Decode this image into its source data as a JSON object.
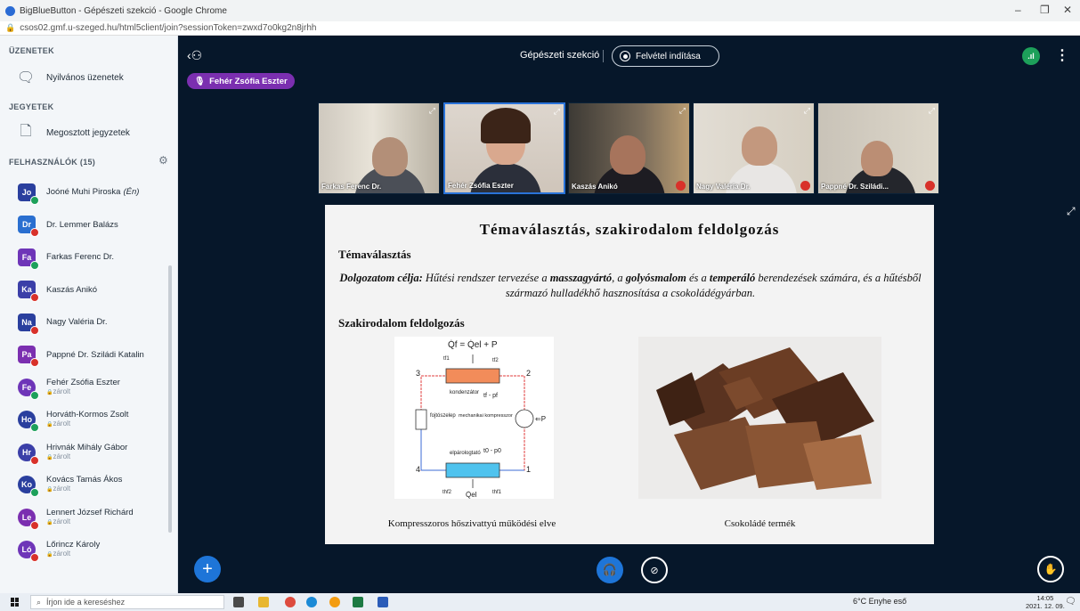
{
  "browser": {
    "title": "BigBlueButton - Gépészeti szekció - Google Chrome",
    "url": "csos02.gmf.u-szeged.hu/html5client/join?sessionToken=zwxd7o0kg2n8jrhh"
  },
  "sidebar": {
    "messages_title": "ÜZENETEK",
    "public_chat": "Nyilvános üzenetek",
    "notes_title": "JEGYETEK",
    "shared_notes": "Megosztott jegyzetek",
    "users_title": "FELHASZNÁLÓK (15)",
    "users": [
      {
        "initials": "Jo",
        "name": "Joóné Muhi Piroska",
        "self": "(Én)",
        "sub": "",
        "color": "#2a3f9e",
        "badge": "#1da05a"
      },
      {
        "initials": "Dr",
        "name": "Dr. Lemmer Balázs",
        "self": "",
        "sub": "",
        "color": "#2a6fd0",
        "badge": "#d8312a"
      },
      {
        "initials": "Fa",
        "name": "Farkas Ferenc Dr.",
        "self": "",
        "sub": "",
        "color": "#6e35b8",
        "badge": "#1da05a"
      },
      {
        "initials": "Ka",
        "name": "Kaszás Anikó",
        "self": "",
        "sub": "",
        "color": "#3b3fa8",
        "badge": "#d8312a"
      },
      {
        "initials": "Na",
        "name": "Nagy Valéria Dr.",
        "self": "",
        "sub": "",
        "color": "#2a3f9e",
        "badge": "#d8312a"
      },
      {
        "initials": "Pa",
        "name": "Pappné Dr. Sziládi Katalin",
        "self": "",
        "sub": "",
        "color": "#7b2fb0",
        "badge": "#d8312a"
      },
      {
        "initials": "Fe",
        "name": "Fehér Zsófia Eszter",
        "self": "",
        "sub": "zárolt",
        "color": "#6e35b8",
        "badge": "#1da05a"
      },
      {
        "initials": "Ho",
        "name": "Horváth-Kormos Zsolt",
        "self": "",
        "sub": "zárolt",
        "color": "#2a3f9e",
        "badge": "#1da05a"
      },
      {
        "initials": "Hr",
        "name": "Hrivnák Mihály Gábor",
        "self": "",
        "sub": "zárolt",
        "color": "#3b3fa8",
        "badge": "#d8312a"
      },
      {
        "initials": "Ko",
        "name": "Kovács Tamás Ákos",
        "self": "",
        "sub": "zárolt",
        "color": "#2a3f9e",
        "badge": "#1da05a"
      },
      {
        "initials": "Le",
        "name": "Lennert József Richárd",
        "self": "",
        "sub": "zárolt",
        "color": "#7b2fb0",
        "badge": "#d8312a"
      },
      {
        "initials": "Ló",
        "name": "Lőrincz Károly",
        "self": "",
        "sub": "zárolt",
        "color": "#6e35b8",
        "badge": "#d8312a"
      }
    ]
  },
  "header": {
    "meeting_title": "Gépészeti szekció",
    "record_label": "Felvétel indítása",
    "talking": "Fehér Zsófia Eszter"
  },
  "webcams": [
    {
      "name": "Farkas Ferenc Dr.",
      "mic": "on"
    },
    {
      "name": "Fehér Zsófia Eszter",
      "mic": "on"
    },
    {
      "name": "Kaszás Anikó",
      "mic": "muted"
    },
    {
      "name": "Nagy Valéria Dr.",
      "mic": "muted"
    },
    {
      "name": "Pappné Dr. Sziládi...",
      "mic": "muted"
    }
  ],
  "slide": {
    "title": "Témaválasztás, szakirodalom feldolgozás",
    "sub1": "Témaválasztás",
    "goal_label": "Dolgozatom célja:",
    "goal_text_1": " Hűtési rendszer tervezése a ",
    "goal_b1": "masszagyártó",
    "goal_text_2": ", a ",
    "goal_b2": "golyósmalom",
    "goal_text_3": " és a ",
    "goal_b3": "temperáló",
    "goal_text_4": " berendezések számára, és a hűtésből származó hulladékhő hasznosítása a csokoládégyárban.",
    "sub2": "Szakirodalom feldolgozás",
    "diagram": {
      "top_formula": "Q̇f = Q̇el + P",
      "condenser": "kondenzátor",
      "cond_state": "tf - pf",
      "valve": "fojtószelep",
      "compressor": "mechanikai kompresszor",
      "power": "⇐P",
      "evaporator": "elpárologtató",
      "evap_state": "t0 - p0",
      "bottom_formula": "Q̇el",
      "n1": "1",
      "n2": "2",
      "n3": "3",
      "n4": "4",
      "tf1": "tf1",
      "tf2": "tf2",
      "thf1": "thf1",
      "thf2": "thf2"
    },
    "caption1": "Kompresszoros hőszivattyú működési elve",
    "caption2": "Csokoládé termék"
  },
  "taskbar": {
    "search_placeholder": "Írjon ide a kereséshez",
    "weather": "6°C  Enyhe eső",
    "time": "14:05",
    "date": "2021. 12. 09."
  }
}
